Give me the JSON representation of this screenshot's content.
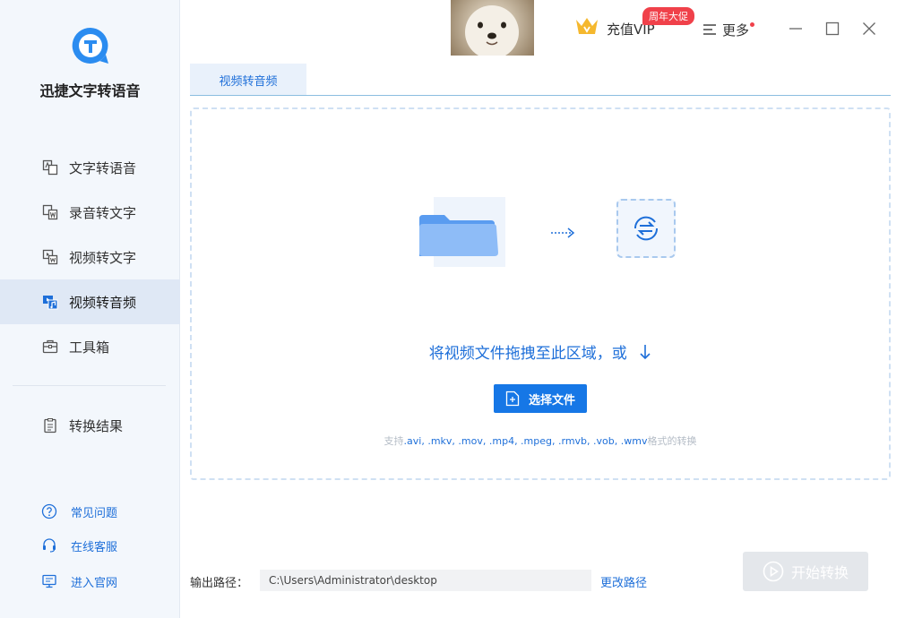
{
  "app": {
    "title": "迅捷文字转语音"
  },
  "sidebar": {
    "items": [
      {
        "label": "文字转语音",
        "icon": "text-to-speech-icon"
      },
      {
        "label": "录音转文字",
        "icon": "audio-to-text-icon"
      },
      {
        "label": "视频转文字",
        "icon": "video-to-text-icon"
      },
      {
        "label": "视频转音频",
        "icon": "video-to-audio-icon",
        "active": true
      },
      {
        "label": "工具箱",
        "icon": "toolbox-icon"
      }
    ],
    "results": {
      "label": "转换结果",
      "icon": "results-icon"
    },
    "help": [
      {
        "label": "常见问题",
        "icon": "question-icon"
      },
      {
        "label": "在线客服",
        "icon": "headset-icon"
      },
      {
        "label": "进入官网",
        "icon": "monitor-icon"
      }
    ]
  },
  "topbar": {
    "vip_label": "充值VIP",
    "vip_badge": "周年大促",
    "more_label": "更多"
  },
  "tabs": [
    {
      "label": "视频转音频"
    }
  ],
  "dropzone": {
    "text": "将视频文件拖拽至此区域，或",
    "select_button": "选择文件",
    "support_prefix": "支持",
    "formats": ".avi, .mkv, .mov, .mp4, .mpeg, .rmvb, .vob, .wmv",
    "support_suffix": "格式的转换"
  },
  "output": {
    "label": "输出路径：",
    "path": "C:\\Users\\Administrator\\desktop",
    "change_label": "更改路径"
  },
  "start_button": "开始转换",
  "colors": {
    "accent": "#1677e6",
    "sidebar_bg": "#f3f7fc",
    "badge": "#f0414a"
  }
}
